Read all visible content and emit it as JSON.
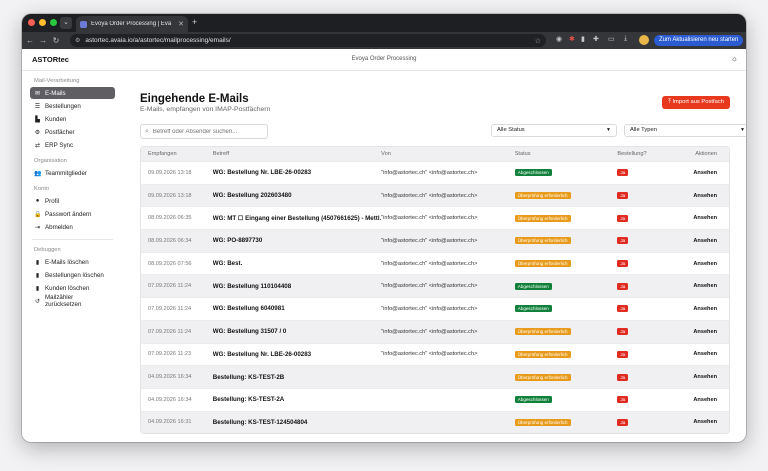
{
  "browser": {
    "tab_title": "Evoya Order Processing | Eva",
    "url": "astortec.avaia.io/a/astortec/mailprocessing/emails/",
    "update_button": "Zum Aktualisieren neu starten"
  },
  "header": {
    "brand": "ASTORtec",
    "title": "Evoya Order Processing"
  },
  "sidebar": {
    "sections": [
      {
        "title": "Mail-Verarbeitung",
        "items": [
          {
            "label": "E-Mails",
            "icon": "mail-icon",
            "active": true
          },
          {
            "label": "Bestellungen",
            "icon": "list-icon"
          },
          {
            "label": "Kunden",
            "icon": "building-icon"
          },
          {
            "label": "Postfächer",
            "icon": "gear-icon"
          },
          {
            "label": "ERP Sync",
            "icon": "sync-icon"
          }
        ]
      },
      {
        "title": "Organisation",
        "items": [
          {
            "label": "Teammitglieder",
            "icon": "users-icon"
          }
        ]
      },
      {
        "title": "Konto",
        "items": [
          {
            "label": "Profil",
            "icon": "user-icon"
          },
          {
            "label": "Passwort ändern",
            "icon": "lock-icon"
          },
          {
            "label": "Abmelden",
            "icon": "logout-icon"
          }
        ]
      },
      {
        "title": "Debuggen",
        "items": [
          {
            "label": "E-Mails löschen",
            "icon": "trash-icon"
          },
          {
            "label": "Bestellungen löschen",
            "icon": "trash-icon"
          },
          {
            "label": "Kunden löschen",
            "icon": "trash-icon"
          },
          {
            "label": "Mailzähler zurücksetzen",
            "icon": "reset-icon"
          }
        ]
      }
    ]
  },
  "main": {
    "title": "Eingehende E-Mails",
    "subtitle": "E-Mails, empfangen von IMAP-Postfächern",
    "import_button": "Import aus Postfach",
    "search_placeholder": "Betreff oder Absender suchen...",
    "filter_status": "Alle Status",
    "filter_type": "Alle Typen",
    "columns": [
      "Empfangen",
      "Betreff",
      "Von",
      "Status",
      "Bestellung?",
      "Aktionen"
    ],
    "rows": [
      {
        "date": "09.09.2026 13:18",
        "subject": "WG: Bestellung Nr. LBE-26-00283",
        "from": "\"info@astortec.ch\" <info@astortec.ch>",
        "status": "Abgeschlossen",
        "status_color": "green",
        "order": "Ja",
        "action": "Ansehen"
      },
      {
        "date": "09.09.2026 13:18",
        "subject": "WG: Bestellung 202603480",
        "from": "\"info@astortec.ch\" <info@astortec.ch>",
        "status": "Überprüfung erforderlich",
        "status_color": "orange",
        "order": "Ja",
        "action": "Ansehen"
      },
      {
        "date": "08.09.2026 06:35",
        "subject": "WG: MT ☐ Eingang einer Bestellung (4507661625) - Mettl…",
        "from": "\"info@astortec.ch\" <info@astortec.ch>",
        "status": "Überprüfung erforderlich",
        "status_color": "orange",
        "order": "Ja",
        "action": "Ansehen"
      },
      {
        "date": "08.09.2026 06:34",
        "subject": "WG: PO-8897730",
        "from": "\"info@astortec.ch\" <info@astortec.ch>",
        "status": "Überprüfung erforderlich",
        "status_color": "orange",
        "order": "Ja",
        "action": "Ansehen"
      },
      {
        "date": "08.09.2026 07:56",
        "subject": "WG: Best.",
        "from": "\"info@astortec.ch\" <info@astortec.ch>",
        "status": "Überprüfung erforderlich",
        "status_color": "orange",
        "order": "Ja",
        "action": "Ansehen"
      },
      {
        "date": "07.09.2026 11:24",
        "subject": "WG: Bestellung 110104408",
        "from": "\"info@astortec.ch\" <info@astortec.ch>",
        "status": "Abgeschlossen",
        "status_color": "green",
        "order": "Ja",
        "action": "Ansehen"
      },
      {
        "date": "07.09.2026 11:24",
        "subject": "WG: Bestellung 6040981",
        "from": "\"info@astortec.ch\" <info@astortec.ch>",
        "status": "Abgeschlossen",
        "status_color": "green",
        "order": "Ja",
        "action": "Ansehen"
      },
      {
        "date": "07.09.2026 11:24",
        "subject": "WG: Bestellung 31507 / 0",
        "from": "\"info@astortec.ch\" <info@astortec.ch>",
        "status": "Überprüfung erforderlich",
        "status_color": "orange",
        "order": "Ja",
        "action": "Ansehen"
      },
      {
        "date": "07.09.2026 11:23",
        "subject": "WG: Bestellung Nr. LBE-26-00283",
        "from": "\"info@astortec.ch\" <info@astortec.ch>",
        "status": "Überprüfung erforderlich",
        "status_color": "orange",
        "order": "Ja",
        "action": "Ansehen"
      },
      {
        "date": "04.09.2026 16:34",
        "subject": "Bestellung: KS-TEST-2B",
        "from": "",
        "status": "Überprüfung erforderlich",
        "status_color": "orange",
        "order": "Ja",
        "action": "Ansehen"
      },
      {
        "date": "04.09.2026 16:34",
        "subject": "Bestellung: KS-TEST-2A",
        "from": "",
        "status": "Abgeschlossen",
        "status_color": "green",
        "order": "Ja",
        "action": "Ansehen"
      },
      {
        "date": "04.09.2026 16:31",
        "subject": "Bestellung: KS-TEST-124504804",
        "from": "",
        "status": "Überprüfung erforderlich",
        "status_color": "orange",
        "order": "Ja",
        "action": "Ansehen"
      }
    ]
  },
  "colors": {
    "accent": "#e8381e",
    "green": "#10803a",
    "orange": "#e89a1a",
    "red": "#e02b20",
    "active_nav": "#5e5e63"
  }
}
